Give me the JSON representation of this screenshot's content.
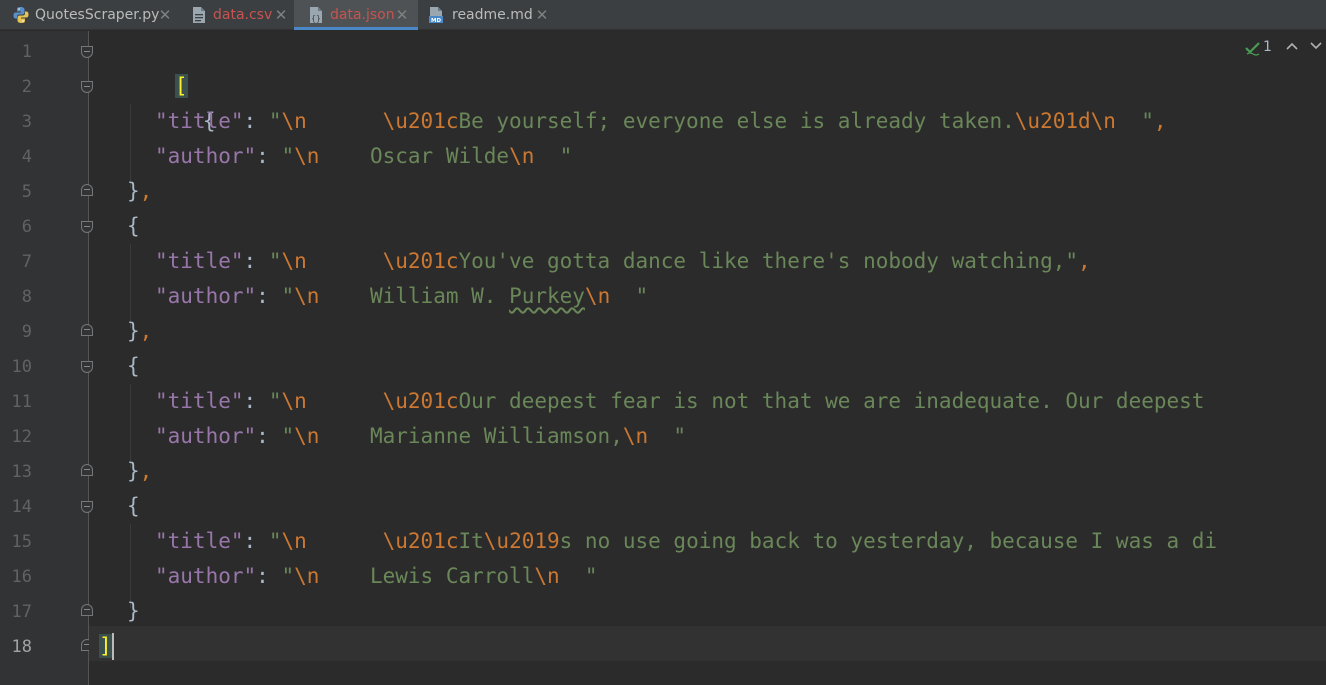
{
  "tabs": [
    {
      "label": "QuotesScraper.py",
      "icon": "python-file-icon",
      "modified": false,
      "active": false
    },
    {
      "label": "data.csv",
      "icon": "csv-file-icon",
      "modified": true,
      "active": false
    },
    {
      "label": "data.json",
      "icon": "json-file-icon",
      "modified": true,
      "active": true
    },
    {
      "label": "readme.md",
      "icon": "markdown-file-icon",
      "modified": false,
      "active": false
    }
  ],
  "close_glyph": "✕",
  "inspection": {
    "count": "1",
    "status_icon": "check-inspection-icon"
  },
  "colors": {
    "background": "#2b2b2b",
    "gutter": "#313335",
    "json_key": "#9876aa",
    "json_string": "#6a8759",
    "escape": "#cc7832",
    "punctuation": "#a9b7c6",
    "active_tab_accent": "#4a88c7",
    "modified_tab": "#c75450"
  },
  "line_numbers": [
    "1",
    "2",
    "3",
    "4",
    "5",
    "6",
    "7",
    "8",
    "9",
    "10",
    "11",
    "12",
    "13",
    "14",
    "15",
    "16",
    "17",
    "18"
  ],
  "current_line": 18,
  "code": {
    "l1": {
      "bracket": "["
    },
    "l2": {
      "brace": "{"
    },
    "l3": {
      "key": "\"title\"",
      "colon": ": ",
      "open": "\"",
      "esc1": "\\n",
      "gap": "      ",
      "esc2": "\\u201c",
      "text": "Be yourself; everyone else is already taken.",
      "esc3": "\\u201d",
      "esc4": "\\n",
      "tail": "  \"",
      "comma": ","
    },
    "l4": {
      "key": "\"author\"",
      "colon": ": ",
      "open": "\"",
      "esc1": "\\n",
      "text": "    Oscar Wilde",
      "esc2": "\\n",
      "tail": "  \""
    },
    "l5": {
      "brace": "}",
      "comma": ","
    },
    "l6": {
      "brace": "{"
    },
    "l7": {
      "key": "\"title\"",
      "colon": ": ",
      "open": "\"",
      "esc1": "\\n",
      "gap": "      ",
      "esc2": "\\u201c",
      "text": "You've gotta dance like there's nobody watching,\"",
      "comma": ","
    },
    "l8": {
      "key": "\"author\"",
      "colon": ": ",
      "open": "\"",
      "esc1": "\\n",
      "text1": "    William W. ",
      "text2": "Purkey",
      "esc2": "\\n",
      "tail": "  \""
    },
    "l9": {
      "brace": "}",
      "comma": ","
    },
    "l10": {
      "brace": "{"
    },
    "l11": {
      "key": "\"title\"",
      "colon": ": ",
      "open": "\"",
      "esc1": "\\n",
      "gap": "      ",
      "esc2": "\\u201c",
      "text": "Our deepest fear is not that we are inadequate. Our deepest"
    },
    "l12": {
      "key": "\"author\"",
      "colon": ": ",
      "open": "\"",
      "esc1": "\\n",
      "text": "    Marianne Williamson,",
      "esc2": "\\n",
      "tail": "  \""
    },
    "l13": {
      "brace": "}",
      "comma": ","
    },
    "l14": {
      "brace": "{"
    },
    "l15": {
      "key": "\"title\"",
      "colon": ": ",
      "open": "\"",
      "esc1": "\\n",
      "gap": "      ",
      "esc2": "\\u201c",
      "text1": "It",
      "esc3": "\\u2019",
      "text2": "s no use going back to yesterday, because I was a di"
    },
    "l16": {
      "key": "\"author\"",
      "colon": ": ",
      "open": "\"",
      "esc1": "\\n",
      "text": "    Lewis Carroll",
      "esc2": "\\n",
      "tail": "  \""
    },
    "l17": {
      "brace": "}"
    },
    "l18": {
      "bracket": "]"
    }
  }
}
